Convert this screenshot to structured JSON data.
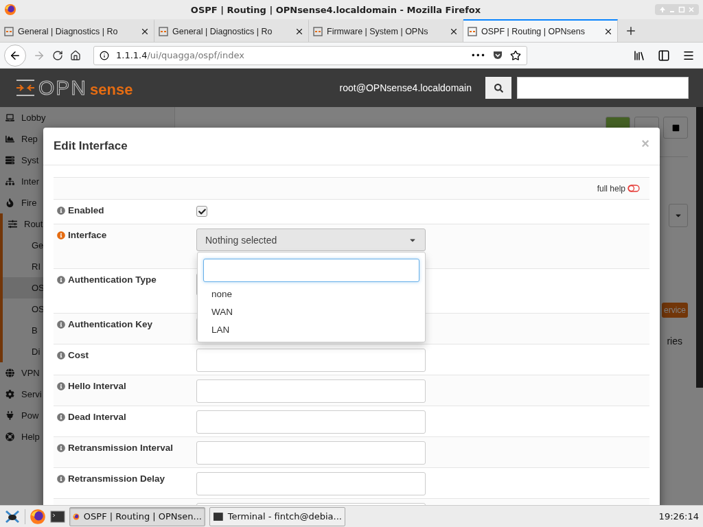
{
  "window": {
    "title": "OSPF | Routing | OPNsense4.localdomain - Mozilla Firefox"
  },
  "tabs": [
    {
      "label": "General | Diagnostics | Ro",
      "selected": false
    },
    {
      "label": "General | Diagnostics | Ro",
      "selected": false
    },
    {
      "label": "Firmware | System | OPNs",
      "selected": false
    },
    {
      "label": "OSPF | Routing | OPNsens",
      "selected": true
    }
  ],
  "address_bar": {
    "host": "1.1.1.4",
    "path": "/ui/quagga/ospf/index",
    "more": "•••"
  },
  "header": {
    "logo_left": "OPN",
    "logo_right": "sense",
    "user": "root@OPNsense4.localdomain"
  },
  "sidebar": {
    "items": [
      {
        "label": "Lobby",
        "selected": false
      },
      {
        "label": "Rep",
        "selected": false
      },
      {
        "label": "Syst",
        "selected": false
      },
      {
        "label": "Inter",
        "selected": false
      },
      {
        "label": "Fire",
        "selected": false
      },
      {
        "label": "Rout",
        "selected": true,
        "children": [
          {
            "label": "Ge",
            "selected": false
          },
          {
            "label": "RI",
            "selected": false
          },
          {
            "label": "OS",
            "selected": true
          },
          {
            "label": "OS",
            "selected": false
          },
          {
            "label": "B",
            "selected": false
          },
          {
            "label": "Di",
            "selected": false
          }
        ]
      },
      {
        "label": "VPN",
        "selected": false
      },
      {
        "label": "Servi",
        "selected": false
      },
      {
        "label": "Pow",
        "selected": false
      },
      {
        "label": "Help",
        "selected": false
      }
    ]
  },
  "page": {
    "service_button": "ervice",
    "side_text": "ries"
  },
  "modal": {
    "title": "Edit Interface",
    "close": "×",
    "full_help": "full help",
    "full_help_on": false,
    "rows": [
      {
        "label": "Enabled",
        "kind": "checkbox",
        "checked": true,
        "highlighted": false
      },
      {
        "label": "Interface",
        "kind": "select",
        "value": "Nothing selected",
        "highlighted": true
      },
      {
        "label": "Authentication Type",
        "kind": "select",
        "highlighted": false
      },
      {
        "label": "Authentication Key",
        "kind": "input",
        "highlighted": false
      },
      {
        "label": "Cost",
        "kind": "input",
        "highlighted": false
      },
      {
        "label": "Hello Interval",
        "kind": "input",
        "highlighted": false
      },
      {
        "label": "Dead Interval",
        "kind": "input",
        "highlighted": false
      },
      {
        "label": "Retransmission Interval",
        "kind": "input",
        "highlighted": false
      },
      {
        "label": "Retransmission Delay",
        "kind": "input",
        "highlighted": false
      },
      {
        "kind": "input"
      }
    ]
  },
  "dropdown": {
    "options": [
      {
        "label": "none",
        "selected": false
      },
      {
        "label": "WAN",
        "selected": false
      },
      {
        "label": "LAN",
        "selected": false
      }
    ]
  },
  "taskbar": {
    "tasks": [
      {
        "label": "OSPF | Routing | OPNsen...",
        "kind": "browser",
        "selected": true
      },
      {
        "label": "Terminal - fintch@debia...",
        "kind": "terminal",
        "selected": false
      }
    ],
    "clock": "19:26:14"
  }
}
